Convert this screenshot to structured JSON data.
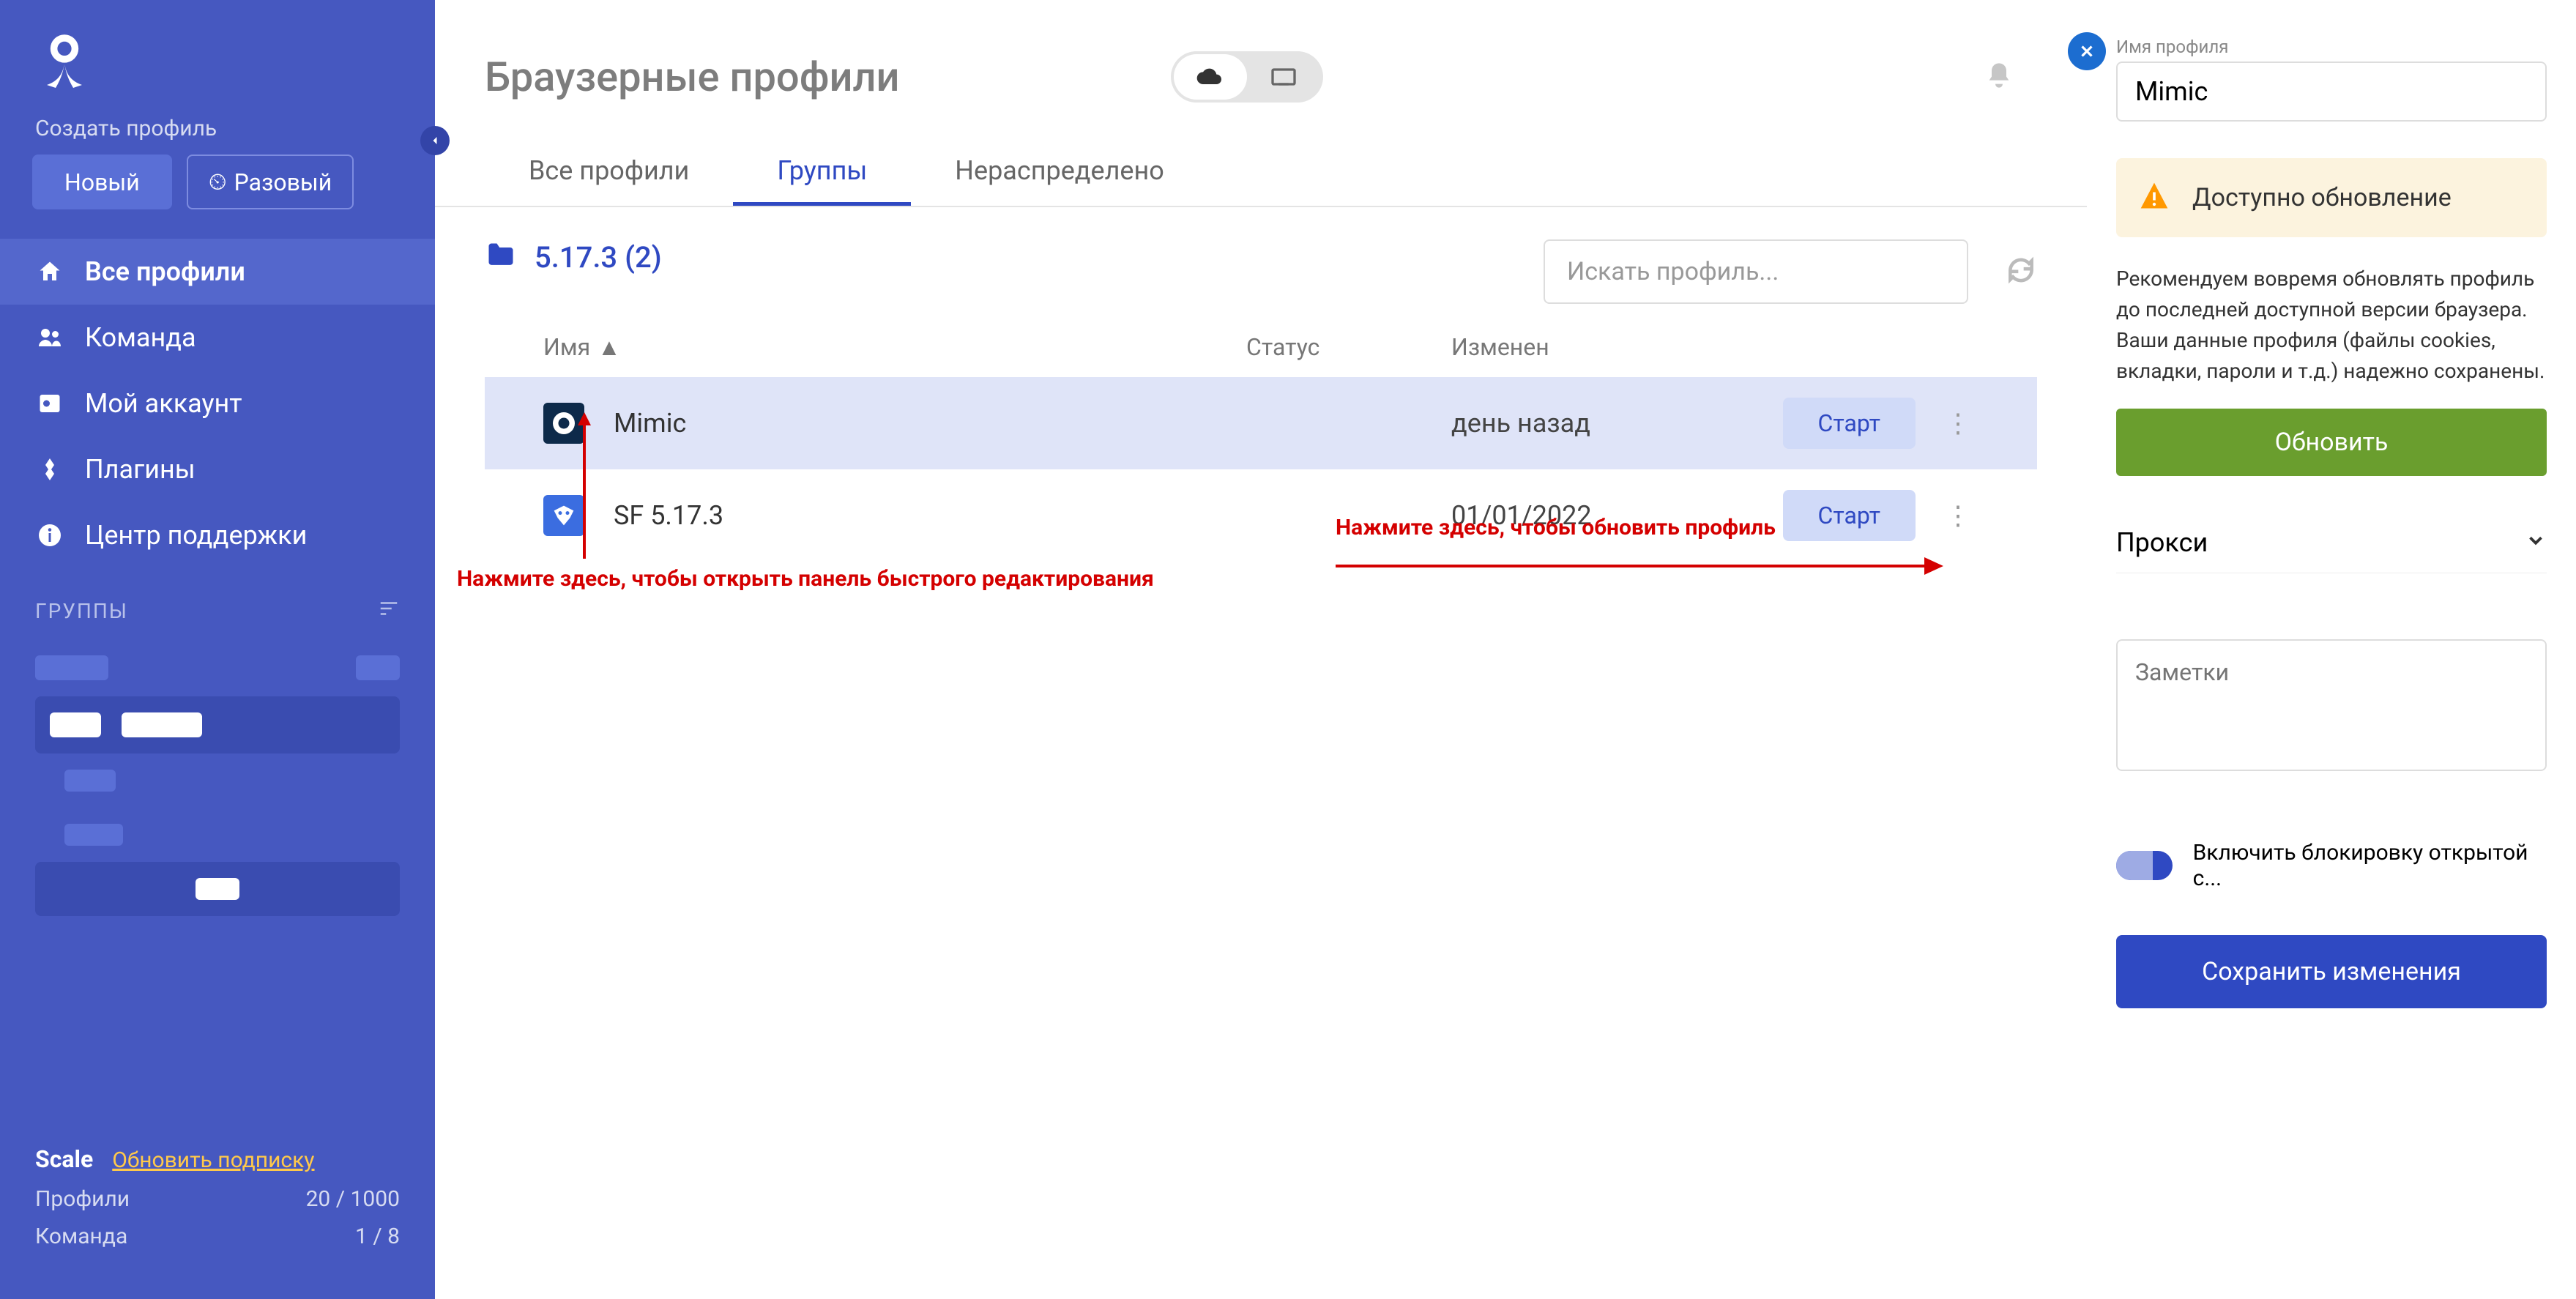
{
  "sidebar": {
    "create_label": "Создать профиль",
    "new_button": "Новый",
    "once_button": "Разовый",
    "nav": [
      {
        "label": "Все профили",
        "icon": "home"
      },
      {
        "label": "Команда",
        "icon": "team"
      },
      {
        "label": "Мой аккаунт",
        "icon": "account"
      },
      {
        "label": "Плагины",
        "icon": "plugins"
      },
      {
        "label": "Центр поддержки",
        "icon": "help"
      }
    ],
    "groups_label": "ГРУППЫ",
    "plan": {
      "name": "Scale",
      "upgrade": "Обновить подписку"
    },
    "stats": [
      {
        "label": "Профили",
        "value": "20 / 1000"
      },
      {
        "label": "Команда",
        "value": "1 / 8"
      }
    ]
  },
  "header": {
    "title": "Браузерные профили"
  },
  "tabs": [
    "Все профили",
    "Группы",
    "Нераспределено"
  ],
  "folder": {
    "name": "5.17.3 (2)"
  },
  "search": {
    "placeholder": "Искать профиль..."
  },
  "columns": {
    "name": "Имя",
    "status": "Статус",
    "modified": "Изменен"
  },
  "rows": [
    {
      "name": "Mimic",
      "modified": "день назад",
      "action": "Старт"
    },
    {
      "name": "SF 5.17.3",
      "modified": "01/01/2022",
      "action": "Старт"
    }
  ],
  "annotations": {
    "edit_hint": "Нажмите здесь, чтобы открыть панель быстрого редактирования",
    "update_hint": "Нажмите здесь, чтобы обновить профиль"
  },
  "panel": {
    "name_label": "Имя профиля",
    "name_value": "Mimic",
    "update_available": "Доступно обновление",
    "update_desc": "Рекомендуем вовремя обновлять профиль до последней доступной версии браузера. Ваши данные профиля (файлы cookies, вкладки, пароли и т.д.) надежно сохранены.",
    "update_button": "Обновить",
    "proxy_label": "Прокси",
    "notes_placeholder": "Заметки",
    "lock_toggle": "Включить блокировку открытой с...",
    "save_button": "Сохранить изменения"
  }
}
